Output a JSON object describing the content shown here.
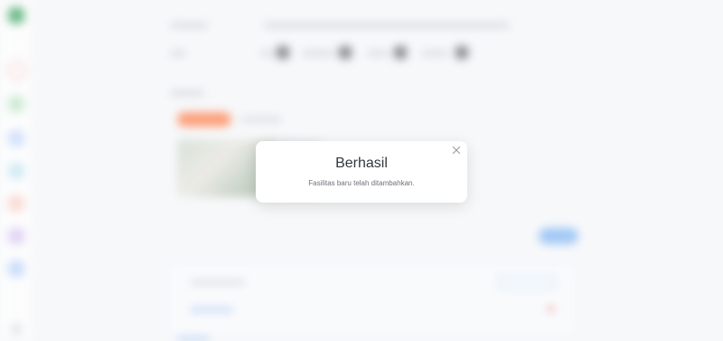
{
  "modal": {
    "title": "Berhasil",
    "message": "Fasilitas baru telah ditambahkan.",
    "close_icon": "close-icon"
  },
  "sidebar": {
    "icons": [
      "logo-icon",
      "add-icon",
      "home-icon",
      "calendar-icon",
      "user-icon",
      "building-icon",
      "list-icon",
      "chart-icon",
      "settings-icon"
    ]
  },
  "colors": {
    "overlay": "#ffffff",
    "accent_orange": "#ff7a45",
    "accent_blue": "#7fb5f5",
    "brand_green": "#37a35b"
  }
}
